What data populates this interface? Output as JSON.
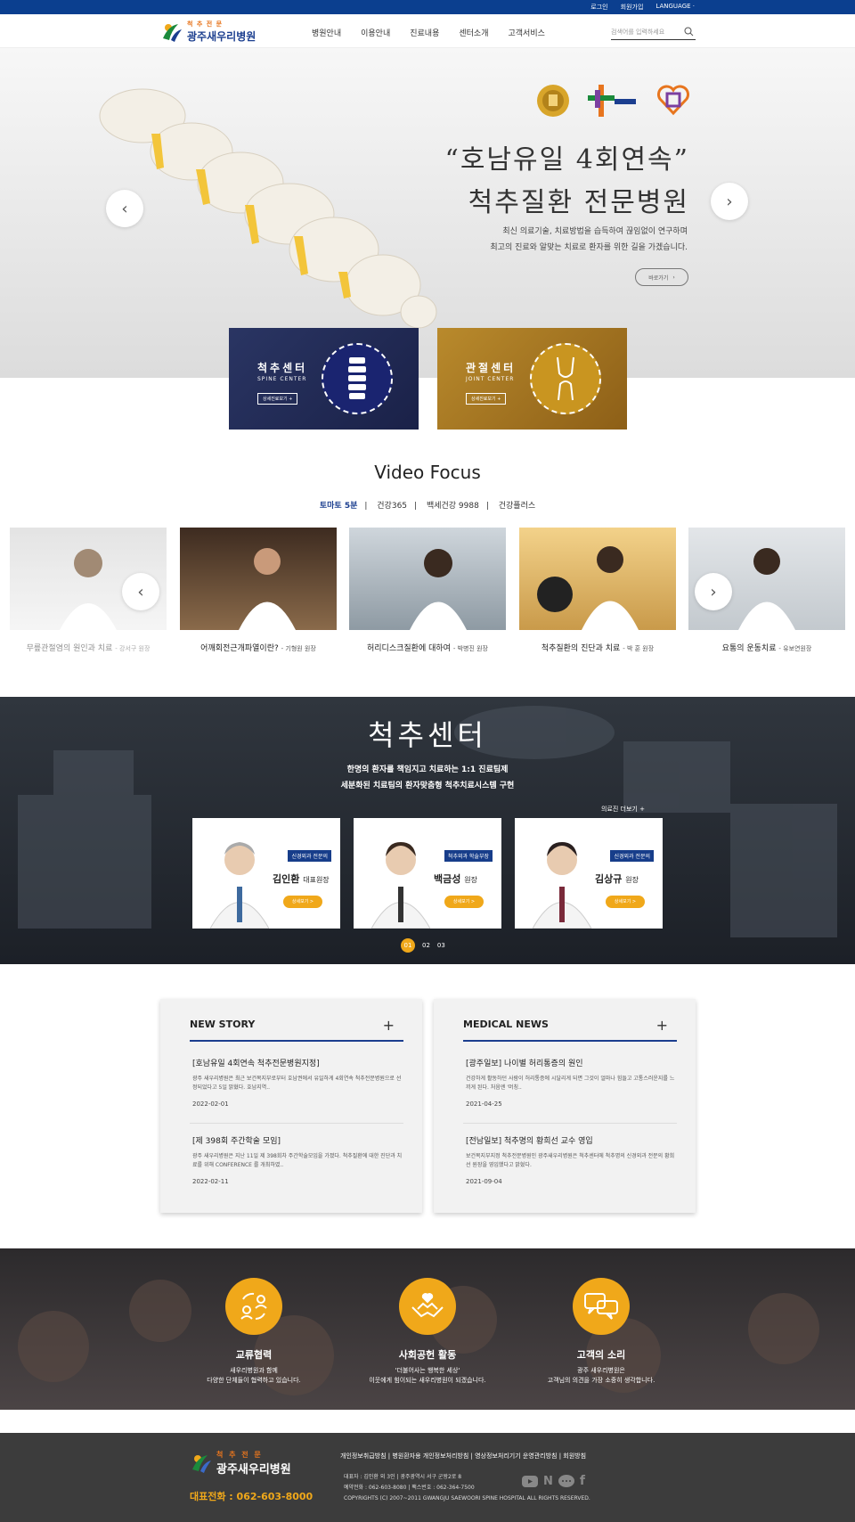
{
  "topbar": {
    "links": [
      "로그인",
      "회원가입",
      "LANGUAGE ·"
    ]
  },
  "logo": {
    "small": "척 추 전 문",
    "big": "광주새우리병원"
  },
  "menu": [
    "병원안내",
    "이용안내",
    "진료내용",
    "센터소개",
    "고객서비스"
  ],
  "search": {
    "placeholder": "검색어를 입력하세요"
  },
  "hero": {
    "title_line1": "“호남유일 4회연속”",
    "title_line2": "척추질환 전문병원",
    "desc_line1": "최신 의료기술, 치료방법을 습득하여 끊임없이 연구하며",
    "desc_line2": "최고의 진료와 알맞는 치료로 환자를 위한 길을 가겠습니다.",
    "button": "바로가기"
  },
  "centers": [
    {
      "title": "척추센터",
      "sub": "SPINE CENTER",
      "btn": "상세진료보기 +"
    },
    {
      "title": "관절센터",
      "sub": "JOINT CENTER",
      "btn": "상세진료보기 +"
    }
  ],
  "video_focus": {
    "title": "Video Focus",
    "tabs": [
      "토마토 5분",
      "건강365",
      "백세건강 9988",
      "건강플러스"
    ],
    "items": [
      {
        "title": "무릎관절염의 원인과 치료",
        "by": "- 강서구 원장"
      },
      {
        "title": "어깨회전근개파열이란?",
        "by": "- 기형원 원장"
      },
      {
        "title": "허리디스크질환에 대하여",
        "by": "- 박병진 원장"
      },
      {
        "title": "척추질환의 진단과 치료",
        "by": "- 박 훈 원장"
      },
      {
        "title": "요통의 운동치료",
        "by": "- 유보연원장"
      }
    ]
  },
  "spine_center": {
    "title": "척추센터",
    "desc_line1": "한명의 환자를 책임지고 치료하는 1:1 진료팀제",
    "desc_line2": "세분화된 치료팀의 환자맞춤형 척추치료시스템 구현",
    "more": "의료진 더보기 +",
    "doctors": [
      {
        "tag": "신경외과 전문의",
        "name": "김인환",
        "role": "대표원장",
        "btn": "상세보기 >"
      },
      {
        "tag": "척추외과 학술부장",
        "name": "백금성",
        "role": "원장",
        "btn": "상세보기 >"
      },
      {
        "tag": "신경외과 전문의",
        "name": "김상규",
        "role": "원장",
        "btn": "상세보기 >"
      }
    ],
    "pager": [
      "01",
      "02",
      "03"
    ]
  },
  "new_story": {
    "title": "NEW STORY",
    "items": [
      {
        "title": "[호남유일 4회연속 척추전문병원지정]",
        "desc": "광주 새우리병원은 최근 보건복지부로부터 호남권에서 유일하게 4회연속 척추전문병원으로 선정되었다고 5일 밝혔다. 호남지역..",
        "date": "2022-02-01"
      },
      {
        "title": "[제 398회 주간학술 모임]",
        "desc": "광주 새우리병원은 지난 11일 제 398회차 주간학술모임을 가졌다. 척추질환에 대한 진단과 치료를 위해 CONFERENCE 를 개최하였..",
        "date": "2022-02-11"
      }
    ]
  },
  "medical_news": {
    "title": "MEDICAL NEWS",
    "items": [
      {
        "title": "[광주일보] 나이별 허리통증의 원인",
        "desc": "건강하게 활동하던 사람이 허리통증에 시달리게 되면 그것이 얼마나 힘들고 고통스러운지를 느끼게 된다. 처음엔 '머칭..",
        "date": "2021-04-25"
      },
      {
        "title": "[전남일보] 척추명의 황희선 교수 영입",
        "desc": "보건복지부지정 척추전문병원인 광주새우리병원은 척추센터에 척추명의 신경외과 전문의 황희선 원장을 영입했다고 밝혔다.",
        "date": "2021-09-04"
      }
    ]
  },
  "community": [
    {
      "title": "교류협력",
      "l1": "새우리병원과 함께",
      "l2": "다양한 단체들이 협력하고 있습니다.",
      "icon": "people-exchange-icon"
    },
    {
      "title": "사회공헌 활동",
      "l1": "'더불어사는 행복한 세상'",
      "l2": "이웃에게 힘이되는 새우리병원이 되겠습니다.",
      "icon": "hands-heart-icon"
    },
    {
      "title": "고객의 소리",
      "l1": "광주 새우리병원은",
      "l2": "고객님의 의견을 가장 소중히 생각합니다.",
      "icon": "speech-bubbles-icon"
    }
  ],
  "footer": {
    "logo_small": "척 추 전 문",
    "logo_big": "광주새우리병원",
    "phone": "대표전화 : 062-603-8000",
    "links": "개인정보취급방침  |  병원환자용 개인정보처리방침  |  영상정보처리기기 운영관리방침  |  회원방침",
    "info1": "대표자 : 김인환 외 3인   |   광주광역시 서구 군왕2로 8",
    "info2": "예약전화 : 062-603-8080   |   팩스번호 : 062-364-7500",
    "copy": "COPYRIGHTS (C) 2007~2011  GWANGJU SAEWOORI SPINE HOSPITAL   ALL RIGHTS RESERVED."
  },
  "colors": {
    "brand_blue": "#0b3f8f",
    "accent_gold": "#f0a81a",
    "navy_box": "#1f2a55",
    "gold_box": "#a7761f"
  }
}
